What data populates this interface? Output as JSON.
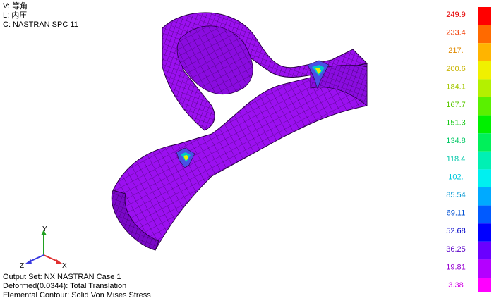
{
  "view": {
    "view_line": "V: 等角",
    "load_line": "L: 内圧",
    "constraint_line": "C: NASTRAN SPC 11"
  },
  "output": {
    "output_set": "Output Set: NX NASTRAN Case 1",
    "deformed": "Deformed(0.0344): Total Translation",
    "contour": "Elemental Contour: Solid Von Mises Stress"
  },
  "triad": {
    "y_label": "Y",
    "z_label": "Z",
    "x_label": "X"
  },
  "legend": {
    "levels": [
      {
        "label": "249.9",
        "color": "#e60000"
      },
      {
        "label": "233.4",
        "color": "#f23a00"
      },
      {
        "label": "217.",
        "color": "#e08a00"
      },
      {
        "label": "200.6",
        "color": "#c8b400"
      },
      {
        "label": "184.1",
        "color": "#a4c800"
      },
      {
        "label": "167.7",
        "color": "#5ac800"
      },
      {
        "label": "151.3",
        "color": "#14c814"
      },
      {
        "label": "134.8",
        "color": "#00c864"
      },
      {
        "label": "118.4",
        "color": "#00c8aa"
      },
      {
        "label": "102.",
        "color": "#00c8dc"
      },
      {
        "label": "85.54",
        "color": "#0096d2"
      },
      {
        "label": "69.11",
        "color": "#0050d2"
      },
      {
        "label": "52.68",
        "color": "#0000c8"
      },
      {
        "label": "36.25",
        "color": "#5a00c8"
      },
      {
        "label": "19.81",
        "color": "#9600d2"
      },
      {
        "label": "3.38",
        "color": "#d200e6"
      }
    ],
    "swatch_colors": [
      "#ff0000",
      "#ff6a00",
      "#ffb400",
      "#f0f000",
      "#b4f000",
      "#5af000",
      "#00f000",
      "#00f05a",
      "#00f0b4",
      "#00f0f0",
      "#00aaff",
      "#005aff",
      "#0000ff",
      "#6a00ff",
      "#b400ff",
      "#ff00ff"
    ]
  },
  "colors": {
    "mesh_fill": "#9b10f0",
    "mesh_fill_dark": "#7a08c8",
    "mesh_line": "#2a0046",
    "hotspot_mid": "#00c8c8",
    "hotspot_core": "#e8f000"
  }
}
